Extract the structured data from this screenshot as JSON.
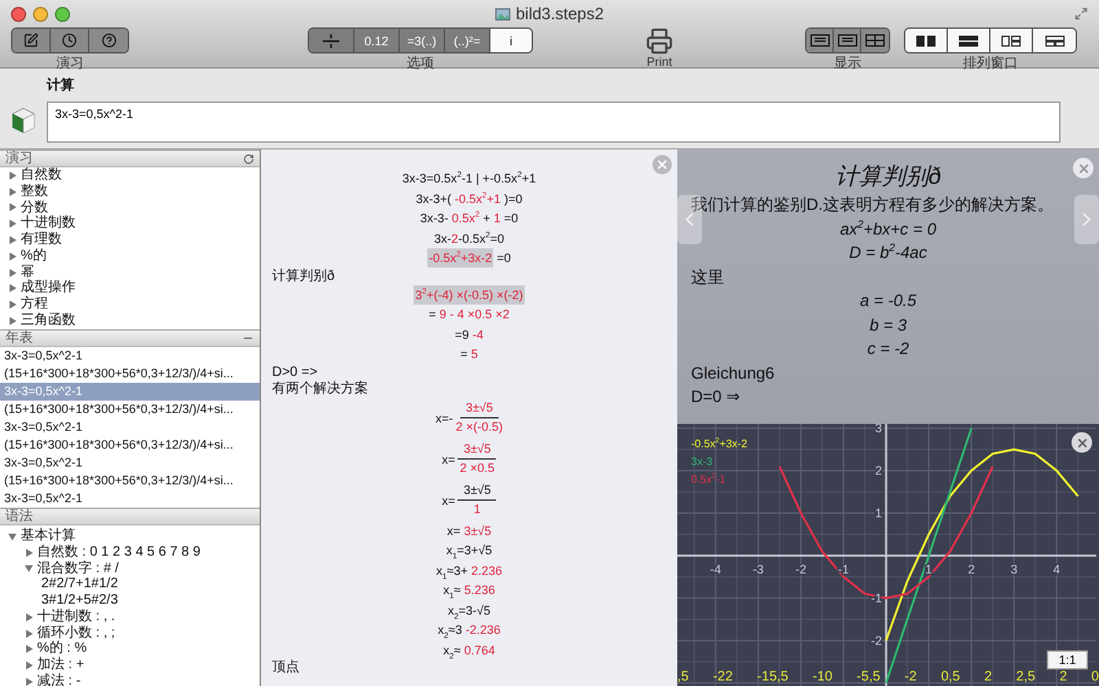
{
  "window": {
    "title": "bild3.steps2"
  },
  "toolbar": {
    "exercise_label": "演习",
    "options_label": "选项",
    "options": [
      {
        "kind": "icon",
        "on": true
      },
      {
        "kind": "text",
        "text": "0.12",
        "on": true
      },
      {
        "kind": "text",
        "text": "=3(..)",
        "on": true
      },
      {
        "kind": "text",
        "text": "(..)²=",
        "on": true
      },
      {
        "kind": "text",
        "text": "i",
        "on": false
      }
    ],
    "print_label": "Print",
    "display_label": "显示",
    "arrange_label": "排列窗口"
  },
  "compute": {
    "label": "计算",
    "value": "3x-3=0,5x^2-1"
  },
  "exercises": {
    "title": "演习",
    "items": [
      {
        "label": "自然数",
        "expanded": false
      },
      {
        "label": "整数",
        "expanded": false
      },
      {
        "label": "分数",
        "expanded": false
      },
      {
        "label": "十进制数",
        "expanded": false
      },
      {
        "label": "有理数",
        "expanded": false
      },
      {
        "label": "%的",
        "expanded": false
      },
      {
        "label": "幂",
        "expanded": false
      },
      {
        "label": "成型操作",
        "expanded": false
      },
      {
        "label": "方程",
        "expanded": false
      },
      {
        "label": "三角函数",
        "expanded": false
      }
    ]
  },
  "history": {
    "title": "年表",
    "rows": [
      {
        "text": "3x-3=0,5x^2-1",
        "selected": false
      },
      {
        "text": "(15+16*300+18*300+56*0,3+12/3/)/4+si...",
        "selected": false
      },
      {
        "text": "3x-3=0,5x^2-1",
        "selected": true
      },
      {
        "text": "(15+16*300+18*300+56*0,3+12/3/)/4+si...",
        "selected": false
      },
      {
        "text": "3x-3=0,5x^2-1",
        "selected": false
      },
      {
        "text": "(15+16*300+18*300+56*0,3+12/3/)/4+si...",
        "selected": false
      },
      {
        "text": "3x-3=0,5x^2-1",
        "selected": false
      },
      {
        "text": "(15+16*300+18*300+56*0,3+12/3/)/4+si...",
        "selected": false
      },
      {
        "text": "3x-3=0,5x^2-1",
        "selected": false
      }
    ]
  },
  "syntax": {
    "title": "语法",
    "items": [
      {
        "label": "基本计算",
        "expanded": true,
        "children": [
          {
            "label": "自然数 : 0 1 2 3 4 5 6 7 8 9",
            "expanded": false
          },
          {
            "label": "混合数字 : # /",
            "expanded": true,
            "children": [
              {
                "label": "2#2/7+1#1/2"
              },
              {
                "label": "3#1/2+5#2/3"
              }
            ]
          },
          {
            "label": "十进制数 : , .",
            "expanded": false
          },
          {
            "label": "循环小数 : , ;",
            "expanded": false
          },
          {
            "label": "%的 : %",
            "expanded": false
          },
          {
            "label": "加法 : +",
            "expanded": false
          },
          {
            "label": "减法 : -",
            "expanded": false
          }
        ]
      }
    ]
  },
  "steps": [
    {
      "kind": "line",
      "segments": [
        {
          "t": "3x-3=0.5x$^{2}$-1 | +-0.5x$^{2}$+1",
          "hl": false
        }
      ]
    },
    {
      "kind": "line",
      "segments": [
        {
          "t": "3x-3+( ",
          "hl": false
        },
        {
          "t": "-0.5x$^{2}$+1",
          "hl": true
        },
        {
          "t": " )=0",
          "hl": false
        }
      ]
    },
    {
      "kind": "line",
      "segments": [
        {
          "t": "3x-3- ",
          "hl": false
        },
        {
          "t": "0.5x$^{2}$",
          "hl": true
        },
        {
          "t": " + ",
          "hl": false
        },
        {
          "t": "1",
          "hl": true
        },
        {
          "t": " =0",
          "hl": false
        }
      ]
    },
    {
      "kind": "line",
      "segments": [
        {
          "t": "3x-",
          "hl": false
        },
        {
          "t": "2",
          "hl": true
        },
        {
          "t": "-0.5x$^{2}$=0",
          "hl": false
        }
      ]
    },
    {
      "kind": "line",
      "segments": [
        {
          "t": "-0.5x$^{2}$+3x-2",
          "hl": true,
          "boxed": true
        },
        {
          "t": " =0",
          "hl": false
        }
      ]
    },
    {
      "kind": "label",
      "text": "计算判别ð"
    },
    {
      "kind": "line",
      "segments": [
        {
          "t": "3$^{2}$+(-4) ×(-0.5) ×(-2)",
          "hl": true,
          "boxed": true
        }
      ]
    },
    {
      "kind": "line",
      "segments": [
        {
          "t": "= ",
          "hl": false
        },
        {
          "t": "9 - 4 ×0.5 ×2",
          "hl": true
        }
      ]
    },
    {
      "kind": "line",
      "segments": [
        {
          "t": "=9 ",
          "hl": false
        },
        {
          "t": "-4",
          "hl": true
        }
      ]
    },
    {
      "kind": "line",
      "segments": [
        {
          "t": "= ",
          "hl": false
        },
        {
          "t": "5",
          "hl": true
        }
      ]
    },
    {
      "kind": "label",
      "text": "D>0 =>"
    },
    {
      "kind": "label",
      "text": "有两个解决方案"
    },
    {
      "kind": "fraction",
      "lead": "x=-",
      "numerator": [
        {
          "t": "3±√5",
          "hl": true
        }
      ],
      "denominator": [
        {
          "t": "2 ×(-0.5)",
          "hl": true
        }
      ]
    },
    {
      "kind": "fraction",
      "lead": "x=",
      "numerator": [
        {
          "t": "3±√5",
          "hl": true
        }
      ],
      "denominator": [
        {
          "t": "2 ×0.5",
          "hl": true
        }
      ]
    },
    {
      "kind": "fraction",
      "lead": "x=",
      "numerator": [
        {
          "t": "3±√5",
          "hl": false
        }
      ],
      "denominator": [
        {
          "t": "1",
          "hl": true
        }
      ]
    },
    {
      "kind": "line",
      "segments": [
        {
          "t": "x= ",
          "hl": false
        },
        {
          "t": "3±√5",
          "hl": true
        }
      ]
    },
    {
      "kind": "line",
      "segments": [
        {
          "t": "x$_{1}$=3+√5",
          "hl": false
        }
      ]
    },
    {
      "kind": "line",
      "segments": [
        {
          "t": "x$_{1}$≈3+ ",
          "hl": false
        },
        {
          "t": "2.236",
          "hl": true
        }
      ]
    },
    {
      "kind": "line",
      "segments": [
        {
          "t": "x$_{1}$≈ ",
          "hl": false
        },
        {
          "t": "5.236",
          "hl": true
        }
      ]
    },
    {
      "kind": "line",
      "segments": [
        {
          "t": "x$_{2}$=3-√5",
          "hl": false
        }
      ]
    },
    {
      "kind": "line",
      "segments": [
        {
          "t": "x$_{2}$≈3 ",
          "hl": false
        },
        {
          "t": "-2.236",
          "hl": true
        }
      ]
    },
    {
      "kind": "line",
      "segments": [
        {
          "t": "x$_{2}$≈ ",
          "hl": false
        },
        {
          "t": "0.764",
          "hl": true
        }
      ]
    },
    {
      "kind": "label",
      "text": "顶点"
    }
  ],
  "explanation": {
    "title": "计算判别ð",
    "lines": [
      {
        "kind": "text",
        "text": "我们计算的鉴别D.这表明方程有多少的解决方案。"
      },
      {
        "kind": "formula",
        "text": "ax$^{2}$+bx+c = 0"
      },
      {
        "kind": "formula",
        "text": "D = b$^{2}$-4ac"
      },
      {
        "kind": "text",
        "text": "这里"
      },
      {
        "kind": "formula",
        "text": "a = -0.5"
      },
      {
        "kind": "formula",
        "text": "b = 3"
      },
      {
        "kind": "formula",
        "text": "c = -2"
      },
      {
        "kind": "text",
        "text": "Gleichung6"
      },
      {
        "kind": "text",
        "text": "D=0 ⇒"
      }
    ]
  },
  "graph": {
    "zoom_button": "1:1",
    "overlay_labels": [
      ",5",
      "-22",
      "-15,5",
      "-10",
      "-5,5",
      "-2",
      "0,5",
      "2",
      "2,5",
      "2",
      "0"
    ],
    "chart_data": {
      "type": "line",
      "grid": true,
      "x": [
        -2.5,
        -2,
        -1.5,
        -1,
        -0.5,
        0,
        0.5,
        1,
        1.5,
        2,
        2.5,
        3,
        3.5,
        4,
        4.5
      ],
      "series": [
        {
          "name": "-0.5x$^{2}$+3x-2",
          "color": "#f2f230",
          "values": [
            null,
            null,
            null,
            null,
            null,
            -2,
            -0.6,
            0.5,
            1.4,
            2,
            2.4,
            2.5,
            2.4,
            2,
            1.4
          ]
        },
        {
          "name": "3x-3",
          "color": "#2fb872",
          "values": [
            null,
            null,
            null,
            null,
            null,
            -3,
            -1.5,
            0,
            1.5,
            3,
            null,
            null,
            null,
            null,
            null
          ]
        },
        {
          "name": "0.5x$^{2}$-1",
          "color": "#e0304a",
          "values": [
            2.1,
            1,
            0.1,
            -0.5,
            -0.9,
            -1,
            -0.9,
            -0.5,
            0.1,
            1,
            2.1,
            null,
            null,
            null,
            null
          ]
        }
      ],
      "xlim": [
        -4.9,
        4.93
      ],
      "ylim": [
        -3.2,
        3.1
      ],
      "xticks": [
        -4,
        -3,
        -2,
        -1,
        1,
        2,
        3,
        4
      ],
      "yticks": [
        -2,
        -1,
        1,
        2,
        3
      ]
    }
  }
}
